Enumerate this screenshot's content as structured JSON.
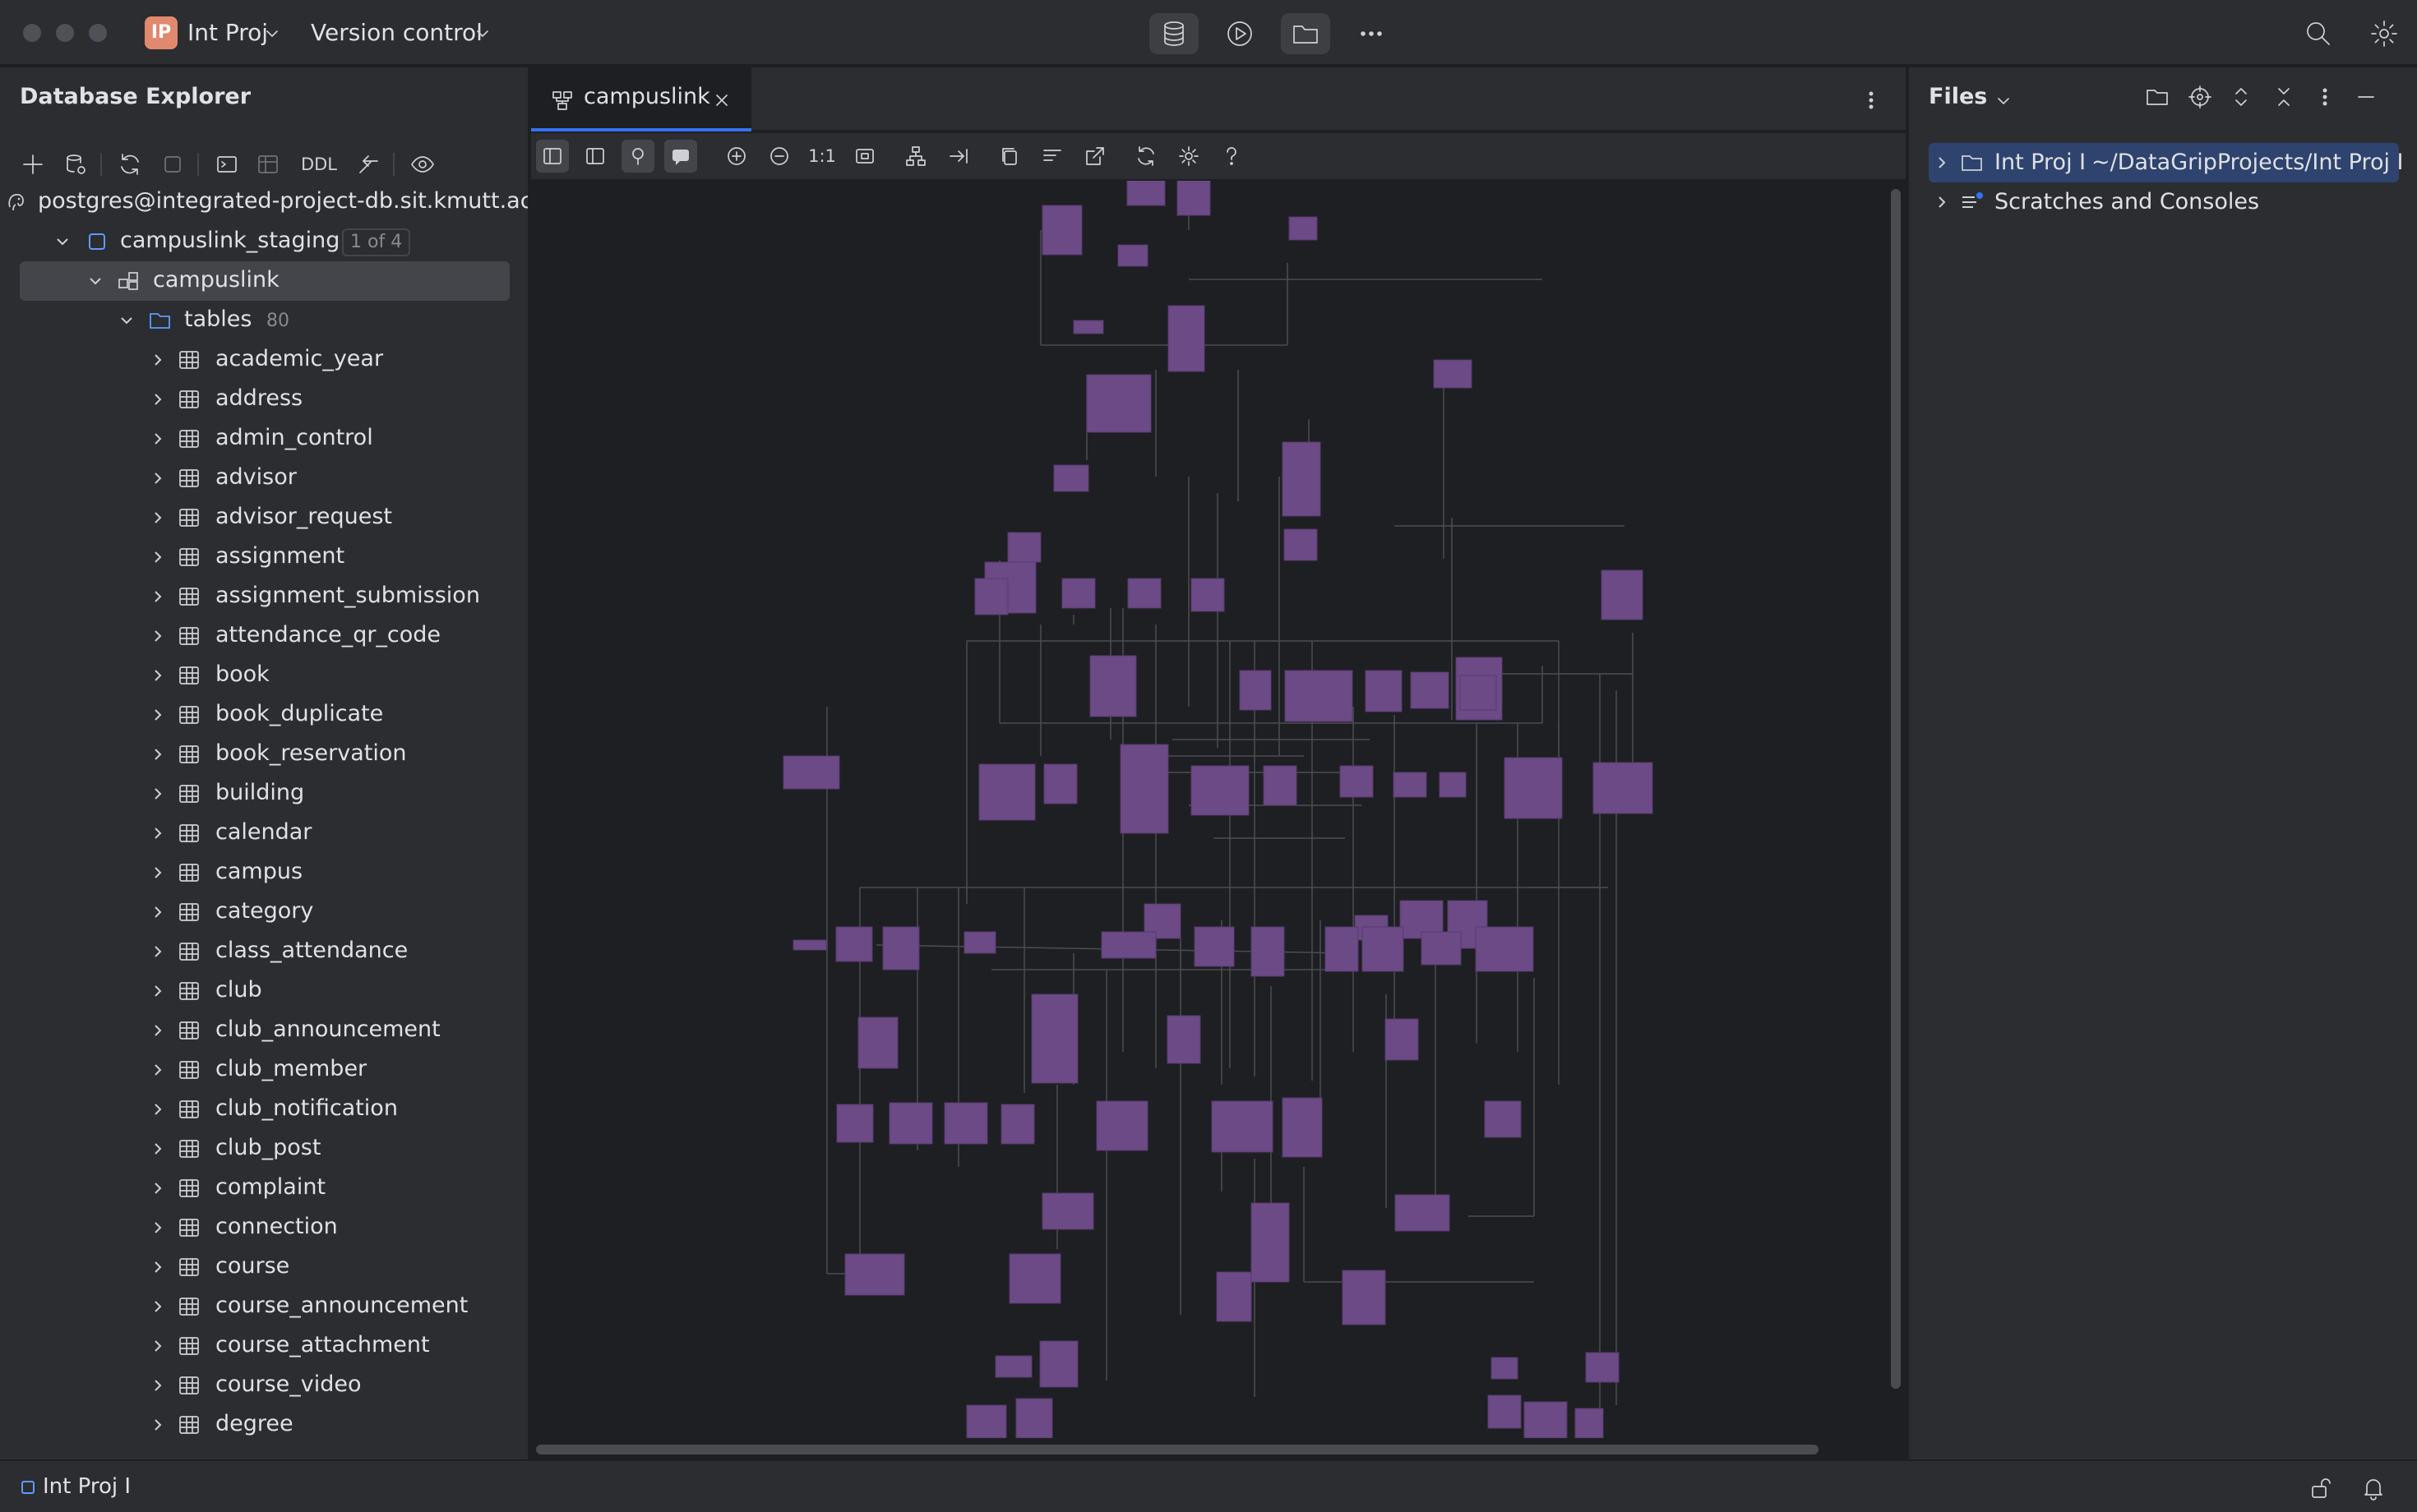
{
  "titlebar": {
    "project_badge": "IP",
    "project_name": "Int Proj",
    "version_control": "Version control",
    "icons": [
      "database-icon",
      "run-icon",
      "folder-icon",
      "more-icon",
      "search-icon",
      "gear-icon"
    ]
  },
  "left_panel": {
    "title": "Database Explorer",
    "toolbar": {
      "ddl_label": "DDL"
    },
    "connection": "postgres@integrated-project-db.sit.kmutt.ac.th",
    "database": {
      "name": "campuslink_staging",
      "badge": "1 of 4"
    },
    "schema": "campuslink",
    "tables_folder": {
      "label": "tables",
      "count": "80"
    },
    "tables": [
      "academic_year",
      "address",
      "admin_control",
      "advisor",
      "advisor_request",
      "assignment",
      "assignment_submission",
      "attendance_qr_code",
      "book",
      "book_duplicate",
      "book_reservation",
      "building",
      "calendar",
      "campus",
      "category",
      "class_attendance",
      "club",
      "club_announcement",
      "club_member",
      "club_notification",
      "club_post",
      "complaint",
      "connection",
      "course",
      "course_announcement",
      "course_attachment",
      "course_video",
      "degree"
    ]
  },
  "editor": {
    "tab_label": "campuslink",
    "zoom_label": "1:1"
  },
  "right_panel": {
    "title": "Files",
    "items": [
      {
        "label": "Int Proj I",
        "path": "~/DataGripProjects/Int Proj I"
      },
      {
        "label": "Scratches and Consoles",
        "path": ""
      }
    ]
  },
  "statusbar": {
    "project": "Int Proj I"
  },
  "colors": {
    "background": "#1e1f22",
    "panel": "#2b2d30",
    "accent": "#3574f0",
    "diagram_node": "#6b4a86",
    "diagram_edge": "#4b4d52"
  }
}
